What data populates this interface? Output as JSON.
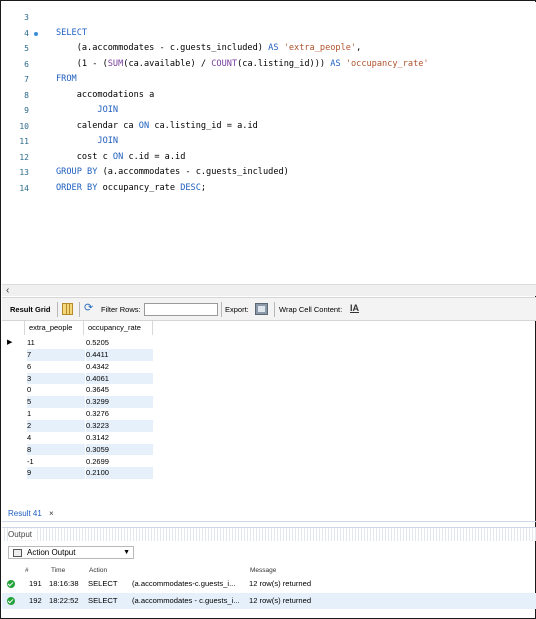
{
  "editor": {
    "lines": [
      {
        "n": "3",
        "marker": false,
        "segs": []
      },
      {
        "n": "4",
        "marker": true,
        "segs": [
          {
            "t": "SELECT",
            "c": "kw"
          }
        ]
      },
      {
        "n": "5",
        "marker": false,
        "segs": [
          {
            "t": "    (a.accommodates - c.guests_included) ",
            "c": ""
          },
          {
            "t": "AS",
            "c": "kw"
          },
          {
            "t": " ",
            "c": ""
          },
          {
            "t": "'extra_people'",
            "c": "str"
          },
          {
            "t": ",",
            "c": ""
          }
        ]
      },
      {
        "n": "6",
        "marker": false,
        "segs": [
          {
            "t": "    (1 - (",
            "c": ""
          },
          {
            "t": "SUM",
            "c": "fn"
          },
          {
            "t": "(ca.available) / ",
            "c": ""
          },
          {
            "t": "COUNT",
            "c": "fn"
          },
          {
            "t": "(ca.listing_id))) ",
            "c": ""
          },
          {
            "t": "AS",
            "c": "kw"
          },
          {
            "t": " ",
            "c": ""
          },
          {
            "t": "'occupancy_rate'",
            "c": "str"
          }
        ]
      },
      {
        "n": "7",
        "marker": false,
        "segs": [
          {
            "t": "FROM",
            "c": "kw"
          }
        ]
      },
      {
        "n": "8",
        "marker": false,
        "segs": [
          {
            "t": "    accomodations a",
            "c": ""
          }
        ]
      },
      {
        "n": "9",
        "marker": false,
        "segs": [
          {
            "t": "        JOIN",
            "c": "kw"
          }
        ]
      },
      {
        "n": "10",
        "marker": false,
        "segs": [
          {
            "t": "    calendar ca ",
            "c": ""
          },
          {
            "t": "ON",
            "c": "kw"
          },
          {
            "t": " ca.listing_id = a.id",
            "c": ""
          }
        ]
      },
      {
        "n": "11",
        "marker": false,
        "segs": [
          {
            "t": "        JOIN",
            "c": "kw"
          }
        ]
      },
      {
        "n": "12",
        "marker": false,
        "segs": [
          {
            "t": "    cost c ",
            "c": ""
          },
          {
            "t": "ON",
            "c": "kw"
          },
          {
            "t": " c.id = a.id",
            "c": ""
          }
        ]
      },
      {
        "n": "13",
        "marker": false,
        "segs": [
          {
            "t": "GROUP BY",
            "c": "kw"
          },
          {
            "t": " (a.accommodates - c.guests_included)",
            "c": ""
          }
        ]
      },
      {
        "n": "14",
        "marker": false,
        "segs": [
          {
            "t": "ORDER BY",
            "c": "kw"
          },
          {
            "t": " occupancy_rate ",
            "c": ""
          },
          {
            "t": "DESC",
            "c": "kw"
          },
          {
            "t": ";",
            "c": ""
          }
        ]
      }
    ]
  },
  "toolbar": {
    "result_grid": "Result Grid",
    "filter_rows": "Filter Rows:",
    "export": "Export:",
    "wrap_cell": "Wrap Cell Content:",
    "wrap_icon": "IA"
  },
  "grid": {
    "columns": [
      "extra_people",
      "occupancy_rate"
    ],
    "rows": [
      [
        "11",
        "0.5205"
      ],
      [
        "7",
        "0.4411"
      ],
      [
        "6",
        "0.4342"
      ],
      [
        "3",
        "0.4061"
      ],
      [
        "0",
        "0.3645"
      ],
      [
        "5",
        "0.3299"
      ],
      [
        "1",
        "0.3276"
      ],
      [
        "2",
        "0.3223"
      ],
      [
        "4",
        "0.3142"
      ],
      [
        "8",
        "0.3059"
      ],
      [
        "-1",
        "0.2699"
      ],
      [
        "9",
        "0.2100"
      ]
    ]
  },
  "result_tab": {
    "label": "Result 41",
    "close": "×"
  },
  "output": {
    "title": "Output",
    "selector": "Action Output",
    "headers": {
      "num": "#",
      "time": "Time",
      "action": "Action",
      "message": "Message"
    },
    "rows": [
      {
        "num": "191",
        "time": "18:16:38",
        "action": "SELECT",
        "detail": "(a.accommodates-c.guests_i...",
        "message": "12 row(s) returned"
      },
      {
        "num": "192",
        "time": "18:22:52",
        "action": "SELECT",
        "detail": "(a.accommodates - c.guests_i...",
        "message": "12 row(s) returned"
      }
    ]
  },
  "colors": {
    "keyword": "#1f5fbf",
    "function": "#7a3fa0",
    "string": "#b0532c",
    "success": "#23a23a",
    "row_highlight": "#e6f0fb"
  }
}
